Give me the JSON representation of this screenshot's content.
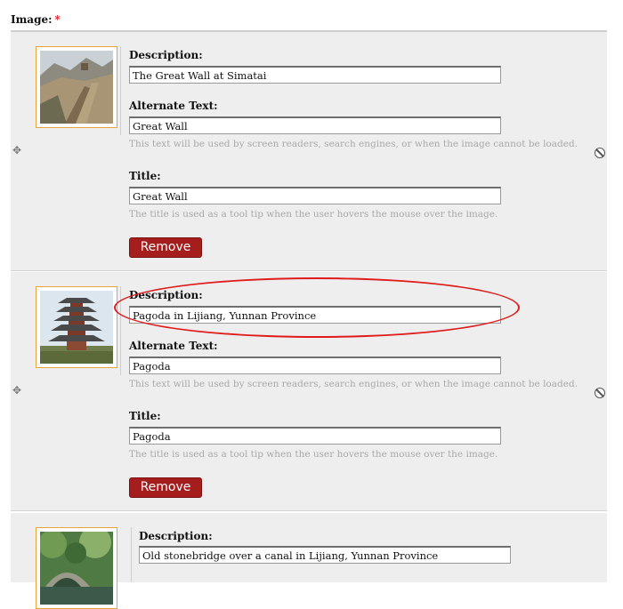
{
  "field": {
    "label": "Image:",
    "required_mark": "*"
  },
  "help_texts": {
    "alt": "This text will be used by screen readers, search engines, or when the image cannot be loaded.",
    "title": "The title is used as a tool tip when the user hovers the mouse over the image."
  },
  "labels": {
    "description": "Description:",
    "alt": "Alternate Text:",
    "title": "Title:"
  },
  "remove_label": "Remove",
  "items": [
    {
      "description": "The Great Wall at Simatai",
      "alt": "Great Wall",
      "title": "Great Wall",
      "thumb": "great-wall-photo"
    },
    {
      "description": "Pagoda in Lijiang, Yunnan Province",
      "alt": "Pagoda",
      "title": "Pagoda",
      "thumb": "pagoda-photo"
    },
    {
      "description": "Old stonebridge over a canal in Lijiang, Yunnan Province",
      "thumb": "stone-bridge-photo"
    }
  ],
  "colors": {
    "accent_remove": "#a51d1d",
    "annotation": "#e01b1b",
    "thumb_border": "#e8a33d"
  },
  "icons": {
    "drag": "drag-handle-icon",
    "remove_all": "no-entry-icon"
  }
}
